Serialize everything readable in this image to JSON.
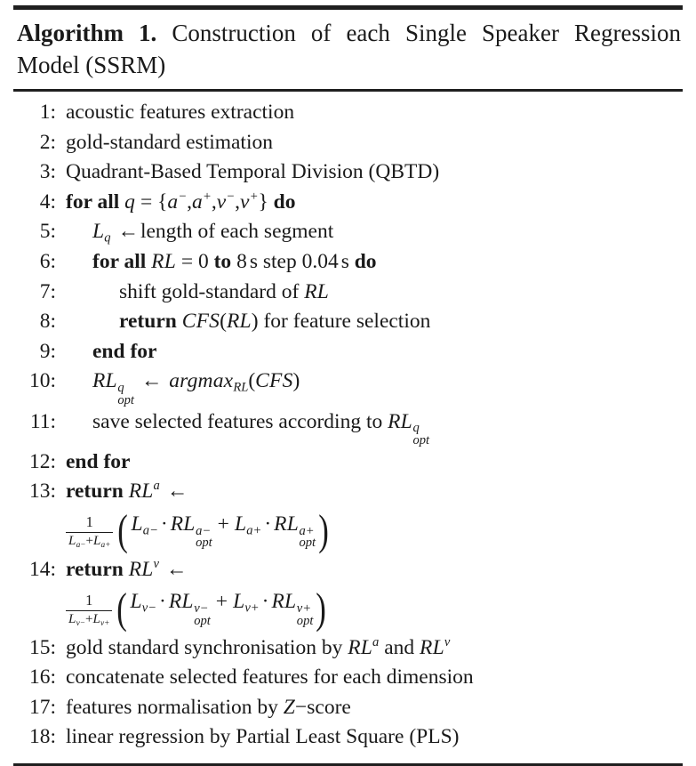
{
  "document": {
    "type": "algorithm-pseudocode",
    "title": {
      "label": "Algorithm 1.",
      "caption": "Construction of each Single Speaker Regression Model (SSRM)"
    },
    "colors": {
      "text": "#1a1a1a",
      "rule": "#1f1f1f",
      "background": "#ffffff"
    },
    "lines": [
      {
        "number": "1",
        "indent": 0,
        "text": "acoustic features extraction"
      },
      {
        "number": "2",
        "indent": 0,
        "text": "gold-standard estimation"
      },
      {
        "number": "3",
        "indent": 0,
        "text": "Quadrant-Based Temporal Division (QBTD)"
      },
      {
        "number": "4",
        "indent": 0,
        "text": "for all q = {a⁻, a⁺, v⁻, v⁺} do",
        "keywords": [
          "for all",
          "do"
        ]
      },
      {
        "number": "5",
        "indent": 1,
        "text": "L_q ← length of each segment"
      },
      {
        "number": "6",
        "indent": 1,
        "text": "for all RL = 0 to 8 s step 0.04 s do",
        "keywords": [
          "for all",
          "to",
          "do"
        ]
      },
      {
        "number": "7",
        "indent": 2,
        "text": "shift gold-standard of RL"
      },
      {
        "number": "8",
        "indent": 2,
        "text": "return CFS(RL) for feature selection",
        "keywords": [
          "return"
        ]
      },
      {
        "number": "9",
        "indent": 1,
        "text": "end for",
        "keywords": [
          "end for"
        ]
      },
      {
        "number": "10",
        "indent": 1,
        "text": "RL^q_opt ← argmax_RL(CFS)"
      },
      {
        "number": "11",
        "indent": 1,
        "text": "save selected features according to RL^q_opt"
      },
      {
        "number": "12",
        "indent": 0,
        "text": "end for",
        "keywords": [
          "end for"
        ]
      },
      {
        "number": "13",
        "indent": 0,
        "text": "return RL^a ←",
        "keywords": [
          "return"
        ]
      },
      {
        "number": "14",
        "indent": 0,
        "text": "return RL^v ←",
        "keywords": [
          "return"
        ]
      },
      {
        "number": "15",
        "indent": 0,
        "text": "gold standard synchronisation by RL^a and RL^v"
      },
      {
        "number": "16",
        "indent": 0,
        "text": "concatenate selected features for each dimension"
      },
      {
        "number": "17",
        "indent": 0,
        "text": "features normalisation by Z−score"
      },
      {
        "number": "18",
        "indent": 0,
        "text": "linear regression by Partial Least Square (PLS)"
      }
    ],
    "tokens": {
      "for_all": "for all",
      "do": "do",
      "to": "to",
      "step": "step",
      "return": "return",
      "end_for": "end for",
      "and": "and",
      "by": "by",
      "of": "of",
      "for": "for",
      "equals": "=",
      "arrow": "←",
      "plus": "+",
      "cdot": "·",
      "minus_sign": "−",
      "paren_open": "(",
      "paren_close": ")",
      "brace_open": "{",
      "brace_close": "}",
      "comma": ","
    },
    "line1": {
      "text": "acoustic features extraction"
    },
    "line2": {
      "text": "gold-standard estimation"
    },
    "line3": {
      "text": "Quadrant-Based Temporal Division (QBTD)"
    },
    "line4": {
      "kw_forall": "for all",
      "var": "q",
      "eq": "=",
      "set": "{",
      "e1": "a",
      "e1sup": "−",
      "e2": "a",
      "e2sup": "+",
      "e3": "v",
      "e3sup": "−",
      "e4": "v",
      "e4sup": "+",
      "set_close": "}",
      "kw_do": "do",
      "comma": ","
    },
    "line5": {
      "var": "L",
      "sub": "q",
      "arrow": "←",
      "text": "length of each segment"
    },
    "line6": {
      "kw_forall": "for all",
      "var": "RL",
      "eq": "=",
      "start": "0",
      "kw_to": "to",
      "end": "8",
      "unit1": "s",
      "step_label": "step",
      "step_val": "0.04",
      "unit2": "s",
      "kw_do": "do"
    },
    "line7": {
      "pre": "shift gold-standard of",
      "var": "RL"
    },
    "line8": {
      "kw_return": "return",
      "fn": "CFS",
      "arg": "RL",
      "post": "for feature selection"
    },
    "line9": {
      "kw": "end for"
    },
    "line10": {
      "var": "RL",
      "sup": "q",
      "sub": "opt",
      "arrow": "←",
      "fn": "argmax",
      "fnsub": "RL",
      "arg": "CFS"
    },
    "line11": {
      "pre": "save selected features according to",
      "var": "RL",
      "sup": "q",
      "sub": "opt"
    },
    "line12": {
      "kw": "end for"
    },
    "line13": {
      "kw_return": "return",
      "var": "RL",
      "sup": "a",
      "arrow": "←",
      "frac_num": "1",
      "frac_den_l1": "L",
      "frac_den_l1sub": "a−",
      "frac_den_plus": "+",
      "frac_den_l2": "L",
      "frac_den_l2sub": "a+",
      "t1_L": "L",
      "t1_Lsub": "a−",
      "cdot": "·",
      "t1_RL": "RL",
      "t1_sup": "a−",
      "t1_sub": "opt",
      "plus": "+",
      "t2_L": "L",
      "t2_Lsub": "a+",
      "t2_RL": "RL",
      "t2_sup": "a+",
      "t2_sub": "opt"
    },
    "line14": {
      "kw_return": "return",
      "var": "RL",
      "sup": "v",
      "arrow": "←",
      "frac_num": "1",
      "frac_den_l1": "L",
      "frac_den_l1sub": "v−",
      "frac_den_plus": "+",
      "frac_den_l2": "L",
      "frac_den_l2sub": "v+",
      "t1_L": "L",
      "t1_Lsub": "v−",
      "cdot": "·",
      "t1_RL": "RL",
      "t1_sup": "v−",
      "t1_sub": "opt",
      "plus": "+",
      "t2_L": "L",
      "t2_Lsub": "v+",
      "t2_RL": "RL",
      "t2_sup": "v+",
      "t2_sub": "opt"
    },
    "line15": {
      "pre": "gold standard synchronisation by",
      "var1": "RL",
      "var1sup": "a",
      "mid": "and",
      "var2": "RL",
      "var2sup": "v"
    },
    "line16": {
      "text": "concatenate selected features for each dimension"
    },
    "line17": {
      "pre": "features normalisation by",
      "var": "Z",
      "post": "−score"
    },
    "line18": {
      "text": "linear regression by Partial Least Square (PLS)"
    }
  }
}
